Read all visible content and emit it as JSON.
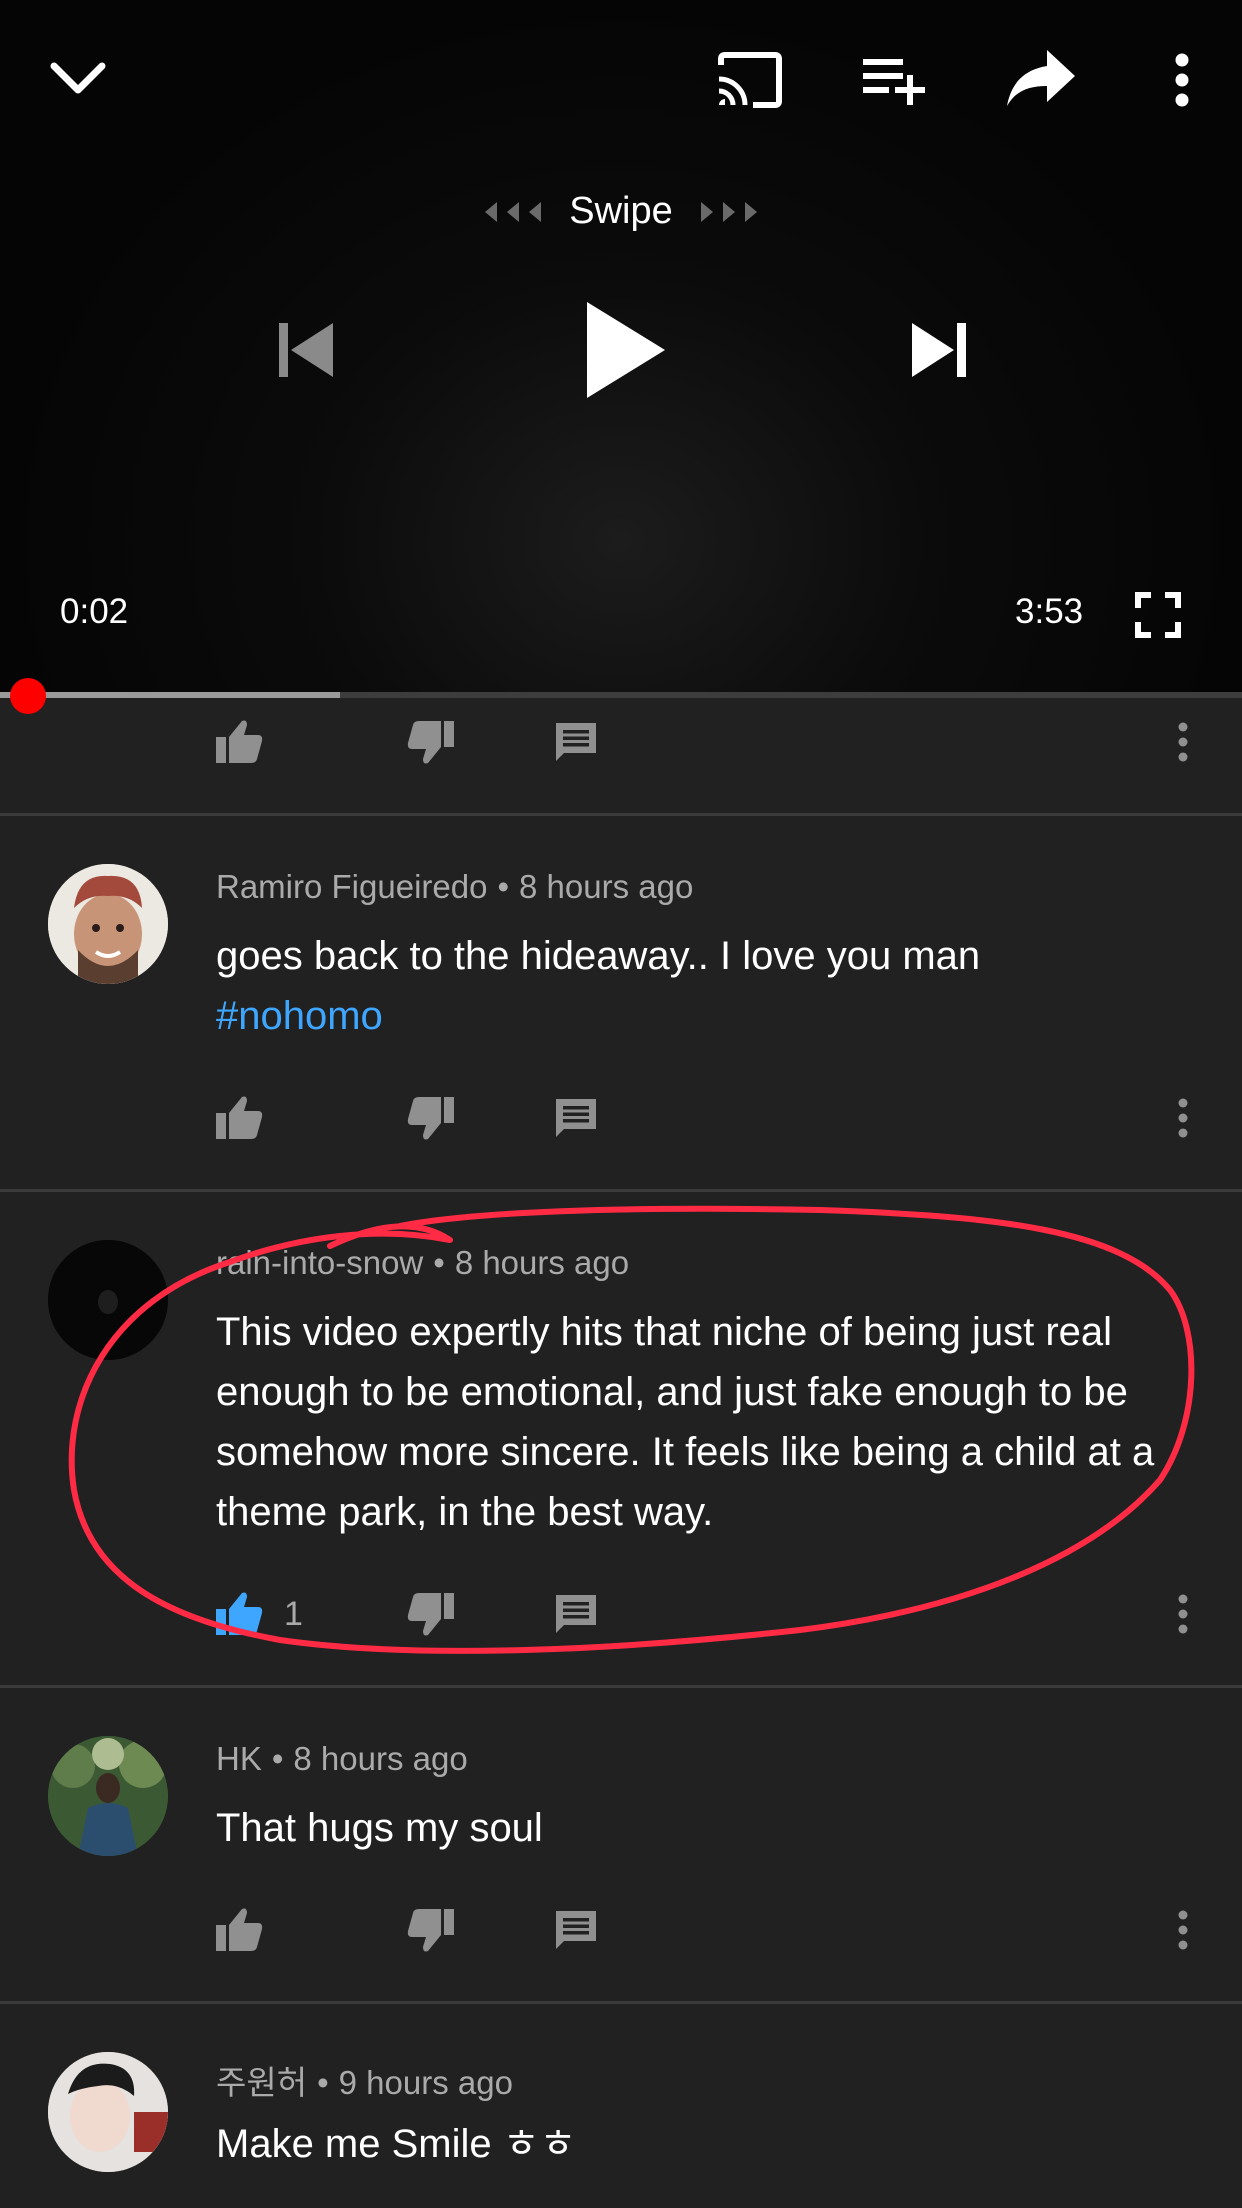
{
  "player": {
    "swipe_label": "Swipe",
    "current_time": "0:02",
    "duration": "3:53",
    "progress_fraction": 0.009,
    "buffered_fraction": 0.274,
    "icons": {
      "collapse": "chevron-down-icon",
      "cast": "cast-icon",
      "add_to_queue": "playlist-add-icon",
      "share": "share-icon",
      "more": "more-vert-icon",
      "previous": "skip-previous-icon",
      "play": "play-icon",
      "next": "skip-next-icon",
      "fullscreen": "fullscreen-icon"
    }
  },
  "colors": {
    "background": "#212121",
    "progress_red": "#ff0000",
    "liked_blue": "#3ea6ff",
    "annotation_red": "#ff2b45"
  },
  "comments": [
    {
      "author": "Ramiro Figueiredo",
      "time": "8 hours ago",
      "text": "goes back to the hideaway.. I love you man ",
      "hashtag": "#nohomo",
      "likes": ""
    },
    {
      "author": "rain-into-snow",
      "time": "8 hours ago",
      "text": "This video expertly hits that niche of being just real enough to be emotional, and just fake enough to be somehow more sincere. It feels like being a child at a theme park, in the best way.",
      "likes": "1",
      "liked": true
    },
    {
      "author": "HK",
      "time": "8 hours ago",
      "text": "That hugs my soul",
      "likes": ""
    },
    {
      "author": "주원허",
      "time": "9 hours ago",
      "text": "Make me Smile ㅎㅎ",
      "likes": ""
    }
  ],
  "separator": "•"
}
